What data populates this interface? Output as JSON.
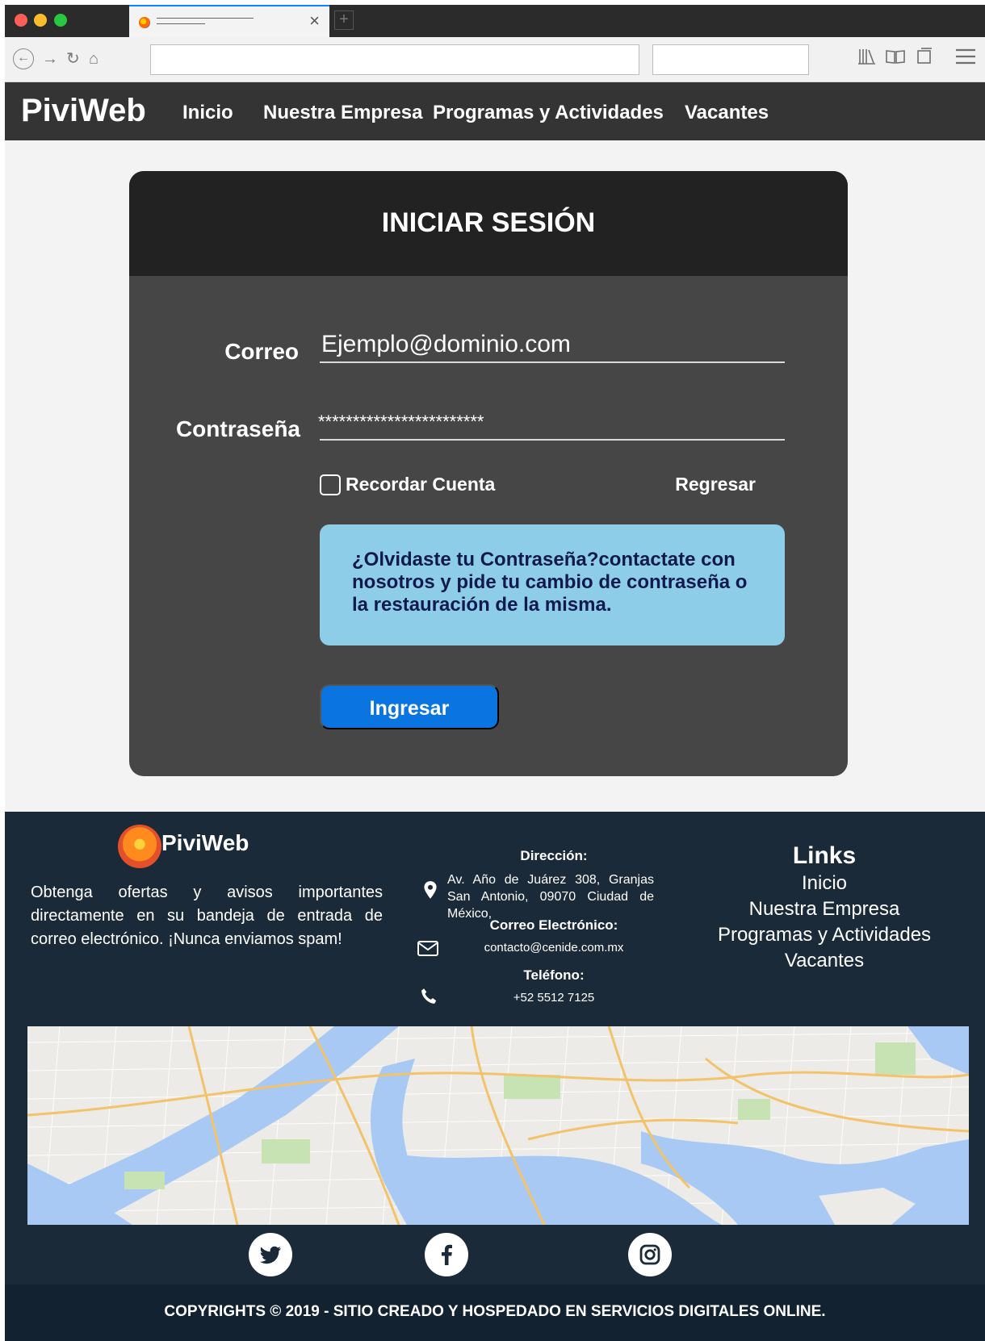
{
  "browser": {
    "traffic_colors": [
      "#fc5f57",
      "#fdbc2e",
      "#28c840"
    ],
    "new_tab_label": "+",
    "close_tab_label": "×"
  },
  "site": {
    "logo": "PiviWeb",
    "nav": [
      "Inicio",
      "Nuestra Empresa",
      "Programas y Actividades",
      "Vacantes"
    ]
  },
  "login": {
    "title": "INICIAR SESIÓN",
    "email_label": "Correo",
    "email_value": "Ejemplo@dominio.com",
    "password_label": "Contraseña",
    "password_value": "************************",
    "remember_label": "Recordar Cuenta",
    "remember_checked": false,
    "back_label": "Regresar",
    "notice": "¿Olvidaste tu Contraseña?contactate con nosotros y pide tu cambio de contraseña o la restauración de la misma.",
    "submit_label": "Ingresar"
  },
  "footer": {
    "logo": "PiviWeb",
    "description": "Obtenga ofertas y avisos importantes directamente en su bandeja de entrada de correo electrónico. ¡Nunca enviamos spam!",
    "address_heading": "Dirección:",
    "address": "Av. Año de Juárez 308, Granjas San Antonio, 09070 Ciudad de México,",
    "email_heading": "Correo Electrónico:",
    "email": "contacto@cenide.com.mx",
    "phone_heading": "Teléfono:",
    "phone": "+52 5512 7125",
    "links_title": "Links",
    "links": [
      "Inicio",
      "Nuestra Empresa",
      "Programas y Actividades",
      "Vacantes"
    ],
    "social": [
      "twitter-icon",
      "facebook-icon",
      "instagram-icon"
    ],
    "copyright": "COPYRIGHTS © 2019 - SITIO CREADO Y HOSPEDADO EN SERVICIOS DIGITALES ONLINE."
  },
  "colors": {
    "nav_bg": "#343434",
    "card_bg": "#464646",
    "card_header_bg": "#222222",
    "notice_bg": "#8ecde8",
    "button_bg": "#0a74e0",
    "footer_bg": "#1b2a38"
  }
}
